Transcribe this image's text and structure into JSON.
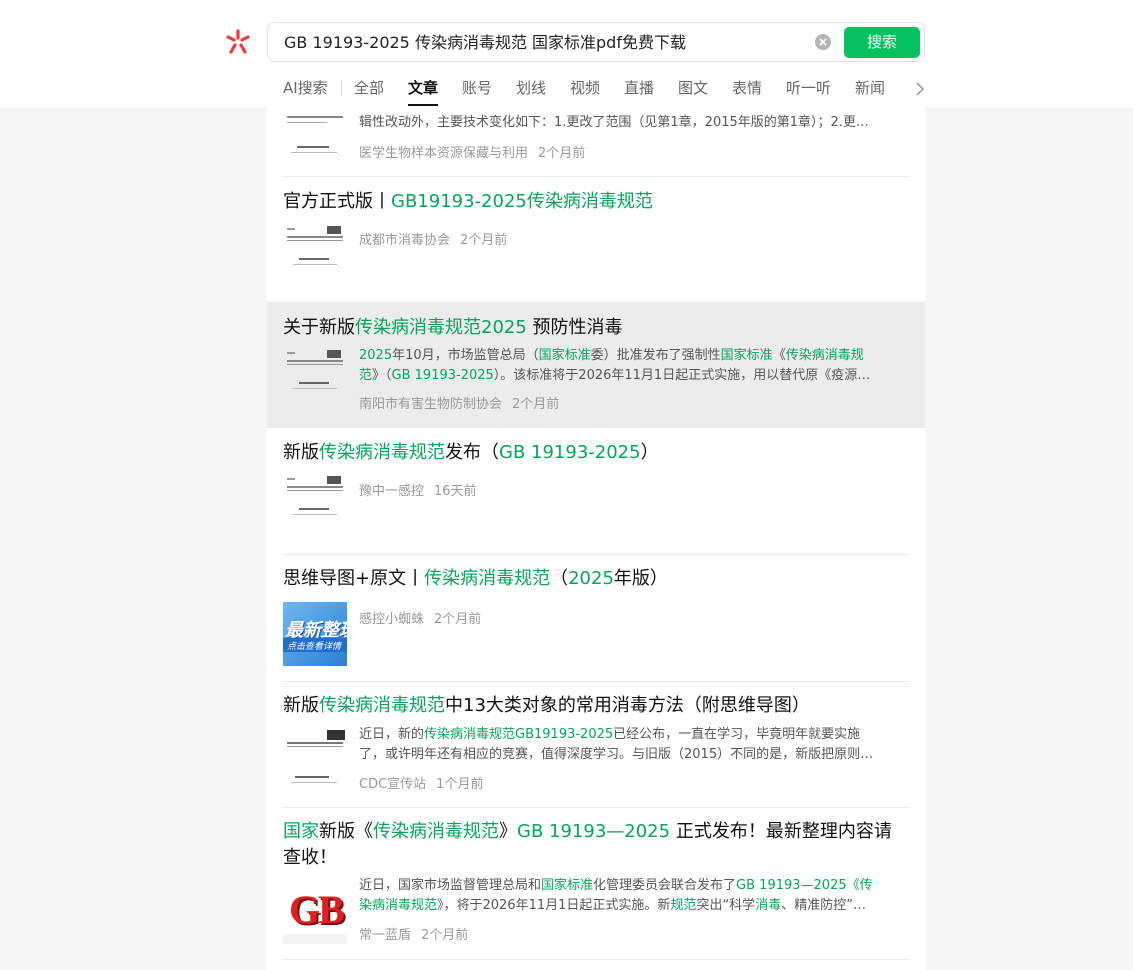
{
  "search": {
    "query": "GB 19193-2025  传染病消毒规范 国家标准pdf免费下载",
    "button": "搜索"
  },
  "tabs": [
    "AI搜索",
    "全部",
    "文章",
    "账号",
    "划线",
    "视频",
    "直播",
    "图文",
    "表情",
    "听一听",
    "新闻"
  ],
  "active_tab": "文章",
  "results": [
    {
      "title_parts": [],
      "desc_lines": [
        "辑性改动外，主要技术变化如下：1.更改了范围（见第1章，2015年版的第1章）；2.更…"
      ],
      "source": "医学生物样本资源保藏与利用",
      "time": "2个月前"
    },
    {
      "title_parts": [
        {
          "text": "官方正式版丨",
          "hl": false
        },
        {
          "text": "GB19193-2025传染病消毒规范",
          "hl": true
        }
      ],
      "source": "成都市消毒协会",
      "time": "2个月前"
    },
    {
      "title_parts": [
        {
          "text": "关于新版",
          "hl": false
        },
        {
          "text": "传染病消毒规范2025",
          "hl": true
        },
        {
          "text": " 预防性消毒",
          "hl": false
        }
      ],
      "desc_lines": [
        [
          {
            "text": "2025",
            "hl": true
          },
          {
            "text": "年10月，市场监管总局（",
            "hl": false
          },
          {
            "text": "国家标准",
            "hl": true
          },
          {
            "text": "委）批准发布了强制性",
            "hl": false
          },
          {
            "text": "国家标准",
            "hl": true
          },
          {
            "text": "《",
            "hl": false
          },
          {
            "text": "传染病消毒规",
            "hl": true
          }
        ],
        [
          {
            "text": "范",
            "hl": true
          },
          {
            "text": "》（",
            "hl": false
          },
          {
            "text": "GB 19193-2025",
            "hl": true
          },
          {
            "text": "）。该标准将于2026年11月1日起正式实施，用以替代原《疫源…",
            "hl": false
          }
        ]
      ],
      "source": "南阳市有害生物防制协会",
      "time": "2个月前"
    },
    {
      "title_parts": [
        {
          "text": "新版",
          "hl": false
        },
        {
          "text": "传染病消毒规范",
          "hl": true
        },
        {
          "text": "发布（",
          "hl": false
        },
        {
          "text": "GB 19193-2025",
          "hl": true
        },
        {
          "text": "）",
          "hl": false
        }
      ],
      "source": "豫中一感控",
      "time": "16天前"
    },
    {
      "title_parts": [
        {
          "text": "思维导图+原文丨",
          "hl": false
        },
        {
          "text": "传染病消毒规范",
          "hl": true
        },
        {
          "text": "（",
          "hl": false
        },
        {
          "text": "2025",
          "hl": true
        },
        {
          "text": "年版）",
          "hl": false
        }
      ],
      "thumb_text": [
        "最新整理",
        "点击查看详情"
      ],
      "source": "感控小蜘蛛",
      "time": "2个月前"
    },
    {
      "title_parts": [
        {
          "text": "新版",
          "hl": false
        },
        {
          "text": "传染病消毒规范",
          "hl": true
        },
        {
          "text": "中13大类对象的常用消毒方法（附思维导图）",
          "hl": false
        }
      ],
      "desc_lines": [
        [
          {
            "text": "近日，新的",
            "hl": false
          },
          {
            "text": "传染病消毒规范GB19193-2025",
            "hl": true
          },
          {
            "text": "已经公布，一直在学习，毕竟明年就要实施",
            "hl": false
          }
        ],
        [
          {
            "text": "了，或许明年还有相应的竞赛，值得深度学习。与旧版（2015）不同的是，新版把原则…",
            "hl": false
          }
        ]
      ],
      "source": "CDC宣传站",
      "time": "1个月前"
    },
    {
      "title_parts": [
        {
          "text": "国家",
          "hl": true
        },
        {
          "text": "新版《",
          "hl": false
        },
        {
          "text": "传染病消毒规范",
          "hl": true
        },
        {
          "text": "》",
          "hl": false
        },
        {
          "text": "GB 19193—2025",
          "hl": true
        },
        {
          "text": " 正式发布！最新整理内容请查收！",
          "hl": false
        }
      ],
      "desc_lines": [
        [
          {
            "text": "近日，国家市场监督管理总局和",
            "hl": false
          },
          {
            "text": "国家标准",
            "hl": true
          },
          {
            "text": "化管理委员会联合发布了",
            "hl": false
          },
          {
            "text": "GB 19193—2025《传",
            "hl": true
          }
        ],
        [
          {
            "text": "染病消毒规范",
            "hl": true
          },
          {
            "text": "》，将于2026年11月1日起正式实施。新",
            "hl": false
          },
          {
            "text": "规范",
            "hl": true
          },
          {
            "text": "突出“科学",
            "hl": false
          },
          {
            "text": "消毒",
            "hl": true
          },
          {
            "text": "、精准防控”…",
            "hl": false
          }
        ]
      ],
      "thumb_text": [
        "GB"
      ],
      "source": "常一蓝盾",
      "time": "2个月前"
    }
  ]
}
